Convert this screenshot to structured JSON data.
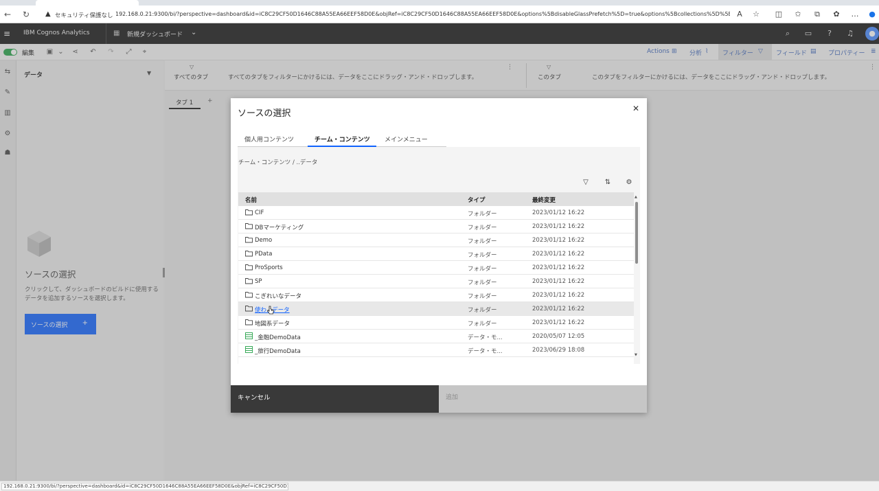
{
  "browser": {
    "security_label": "セキュリティ保護なし",
    "url": "192.168.0.21:9300/bi/?perspective=dashboard&id=iC8C29CF50D1646C88A55EA66EEF58D0E&objRef=iC8C29CF50D1646C88A55EA66EEF58D0E&options%5BdisableGlassPrefetch%5D=true&options%5Bcollections%5D%5Bcanva...",
    "status_url": "192.168.0.21:9300/bi/?perspective=dashboard&id=iC8C29CF50D1646C88A55EA66EEF58D0E&objRef=iC8C29CF50D1646C8..."
  },
  "app": {
    "brand": "IBM Cognos Analytics",
    "dashboard_title": "新規ダッシュボード"
  },
  "toolbar": {
    "edit_label": "編集",
    "actions": [
      {
        "label": "Actions"
      },
      {
        "label": "分析"
      },
      {
        "label": "フィルター"
      },
      {
        "label": "フィールド"
      },
      {
        "label": "プロパティー"
      }
    ]
  },
  "data_panel": {
    "title": "データ",
    "source_title": "ソースの選択",
    "description": "クリックして、ダッシュボードのビルドに使用するデータを追加するソースを選択します。",
    "button_label": "ソースの選択"
  },
  "filter_bar": {
    "all_tabs_label": "すべてのタブ",
    "all_tabs_hint": "すべてのタブをフィルターにかけるには、データをここにドラッグ・アンド・ドロップします。",
    "this_tab_label": "このタブ",
    "this_tab_hint": "このタブをフィルターにかけるには、データをここにドラッグ・アンド・ドロップします。"
  },
  "canvas": {
    "tab_label": "タブ 1",
    "tab_add": "+"
  },
  "modal": {
    "title": "ソースの選択",
    "tabs": [
      {
        "label": "個人用コンテンツ"
      },
      {
        "label": "チーム・コンテンツ"
      },
      {
        "label": "メインメニュー"
      }
    ],
    "breadcrumb": "チーム・コンテンツ / ..データ",
    "columns": {
      "name": "名前",
      "type": "タイプ",
      "modified": "最終変更"
    },
    "rows": [
      {
        "name": "CIF",
        "type": "フォルダー",
        "modified": "2023/01/12 16:22",
        "icon": "folder"
      },
      {
        "name": "DBマーケティング",
        "type": "フォルダー",
        "modified": "2023/01/12 16:22",
        "icon": "folder"
      },
      {
        "name": "Demo",
        "type": "フォルダー",
        "modified": "2023/01/12 16:22",
        "icon": "folder"
      },
      {
        "name": "PData",
        "type": "フォルダー",
        "modified": "2023/01/12 16:22",
        "icon": "folder"
      },
      {
        "name": "ProSports",
        "type": "フォルダー",
        "modified": "2023/01/12 16:22",
        "icon": "folder"
      },
      {
        "name": "SP",
        "type": "フォルダー",
        "modified": "2023/01/12 16:22",
        "icon": "folder"
      },
      {
        "name": "こぎれいなデータ",
        "type": "フォルダー",
        "modified": "2023/01/12 16:22",
        "icon": "folder"
      },
      {
        "name": "使わ...データ",
        "type": "フォルダー",
        "modified": "2023/01/12 16:22",
        "icon": "folder",
        "hover": true
      },
      {
        "name": "地図系データ",
        "type": "フォルダー",
        "modified": "2023/01/12 16:22",
        "icon": "folder"
      },
      {
        "name": "_金融DemoData",
        "type": "データ・モ...",
        "modified": "2020/05/07 12:05",
        "icon": "data-module"
      },
      {
        "name": "_旅行DemoData",
        "type": "データ・モ...",
        "modified": "2023/06/29 18:08",
        "icon": "data-module"
      }
    ],
    "cancel_label": "キャンセル",
    "add_label": "追加"
  }
}
